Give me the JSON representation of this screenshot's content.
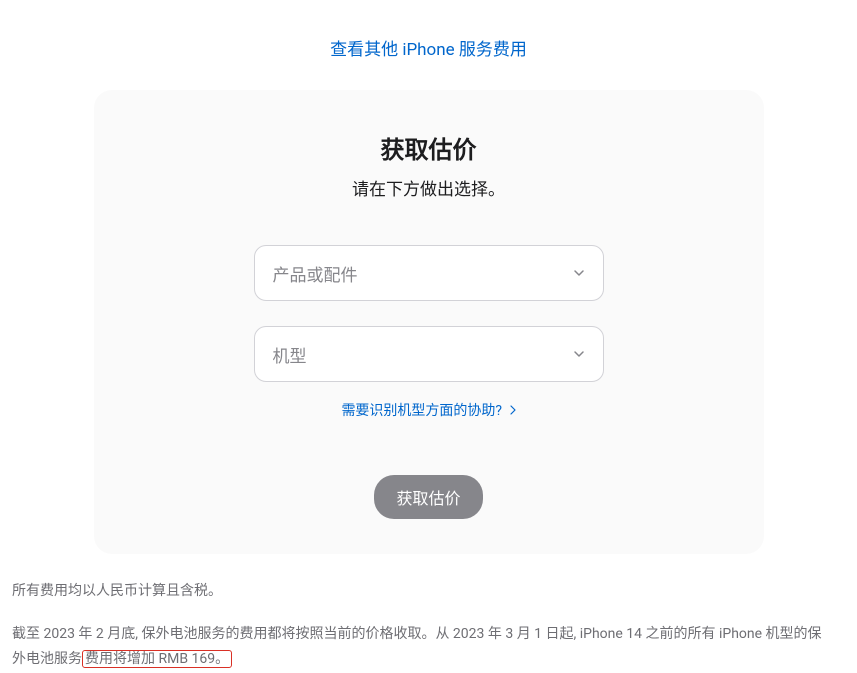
{
  "topLink": {
    "text": "查看其他 iPhone 服务费用"
  },
  "card": {
    "title": "获取估价",
    "subtitle": "请在下方做出选择。",
    "select1": {
      "placeholder": "产品或配件"
    },
    "select2": {
      "placeholder": "机型"
    },
    "helpLink": {
      "text": "需要识别机型方面的协助?"
    },
    "submitButton": {
      "label": "获取估价"
    }
  },
  "footer": {
    "line1": "所有费用均以人民币计算且含税。",
    "line2a": "截至 2023 年 2 月底, 保外电池服务的费用都将按照当前的价格收取。从 2023 年 3 月 1 日起, iPhone 14 之前的所有 iPhone 机型的保外电池服务",
    "line2b": "费用将增加 RMB 169。"
  }
}
